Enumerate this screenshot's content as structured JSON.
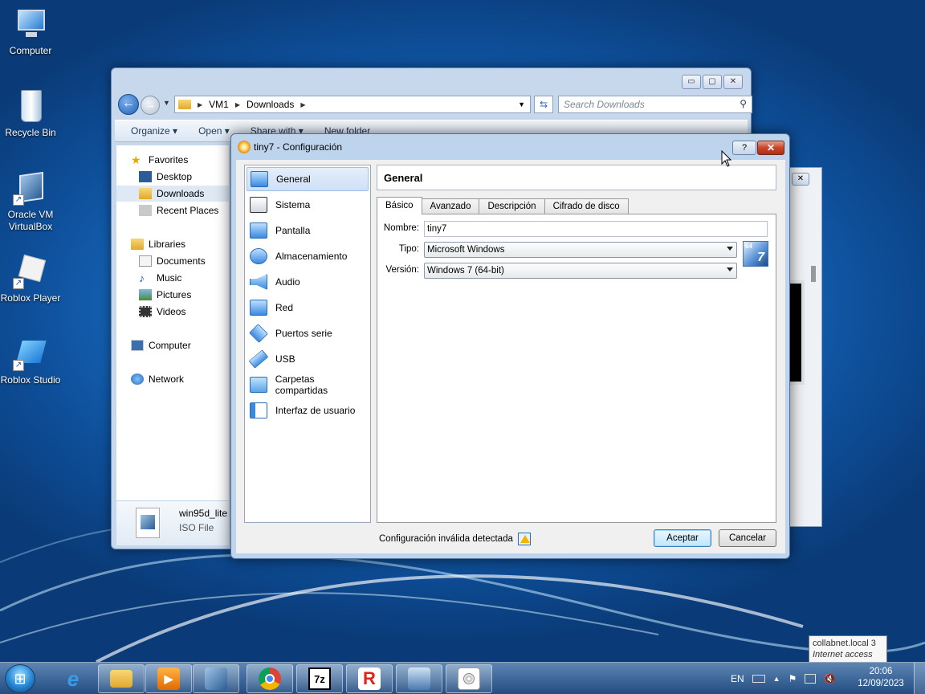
{
  "desktop": {
    "icons": [
      {
        "label": "Computer"
      },
      {
        "label": "Recycle Bin"
      },
      {
        "label": "Oracle VM VirtualBox"
      },
      {
        "label": "Roblox Player"
      },
      {
        "label": "Roblox Studio"
      }
    ]
  },
  "explorer": {
    "breadcrumb": [
      "VM1",
      "Downloads"
    ],
    "search_placeholder": "Search Downloads",
    "toolbar": {
      "organize": "Organize ▾",
      "open": "Open ▾",
      "share": "Share with ▾",
      "new_folder": "New folder"
    },
    "nav": {
      "favorites": "Favorites",
      "desktop": "Desktop",
      "downloads": "Downloads",
      "recent": "Recent Places",
      "libraries": "Libraries",
      "documents": "Documents",
      "music": "Music",
      "pictures": "Pictures",
      "videos": "Videos",
      "computer": "Computer",
      "network": "Network"
    },
    "details": {
      "file_name": "win95d_lite",
      "file_type": "ISO File"
    }
  },
  "dialog": {
    "title": "tiny7 - Configuración",
    "help": "?",
    "close": "✕",
    "sidebar": [
      {
        "label": "General"
      },
      {
        "label": "Sistema"
      },
      {
        "label": "Pantalla"
      },
      {
        "label": "Almacenamiento"
      },
      {
        "label": "Audio"
      },
      {
        "label": "Red"
      },
      {
        "label": "Puertos serie"
      },
      {
        "label": "USB"
      },
      {
        "label": "Carpetas compartidas"
      },
      {
        "label": "Interfaz de usuario"
      }
    ],
    "section_title": "General",
    "tabs": [
      {
        "label": "Básico"
      },
      {
        "label": "Avanzado"
      },
      {
        "label": "Descripción"
      },
      {
        "label": "Cifrado de disco"
      }
    ],
    "form": {
      "name_label": "Nombre:",
      "name_value": "tiny7",
      "type_label": "Tipo:",
      "type_value": "Microsoft Windows",
      "version_label": "Versión:",
      "version_value": "Windows 7 (64-bit)",
      "os_badge_bits": "64",
      "os_badge_version": "7"
    },
    "status": "Configuración inválida detectada",
    "ok": "Aceptar",
    "cancel": "Cancelar"
  },
  "tooltip": {
    "line1": "collabnet.local",
    "count": "3",
    "line2": "Internet access"
  },
  "taskbar": {
    "lang": "EN",
    "time": "20:06",
    "date": "12/09/2023",
    "apps": [
      "explorer",
      "media-player",
      "virtualbox",
      "chrome",
      "7zip",
      "roblox-studio",
      "network-tool",
      "iso-file"
    ]
  }
}
